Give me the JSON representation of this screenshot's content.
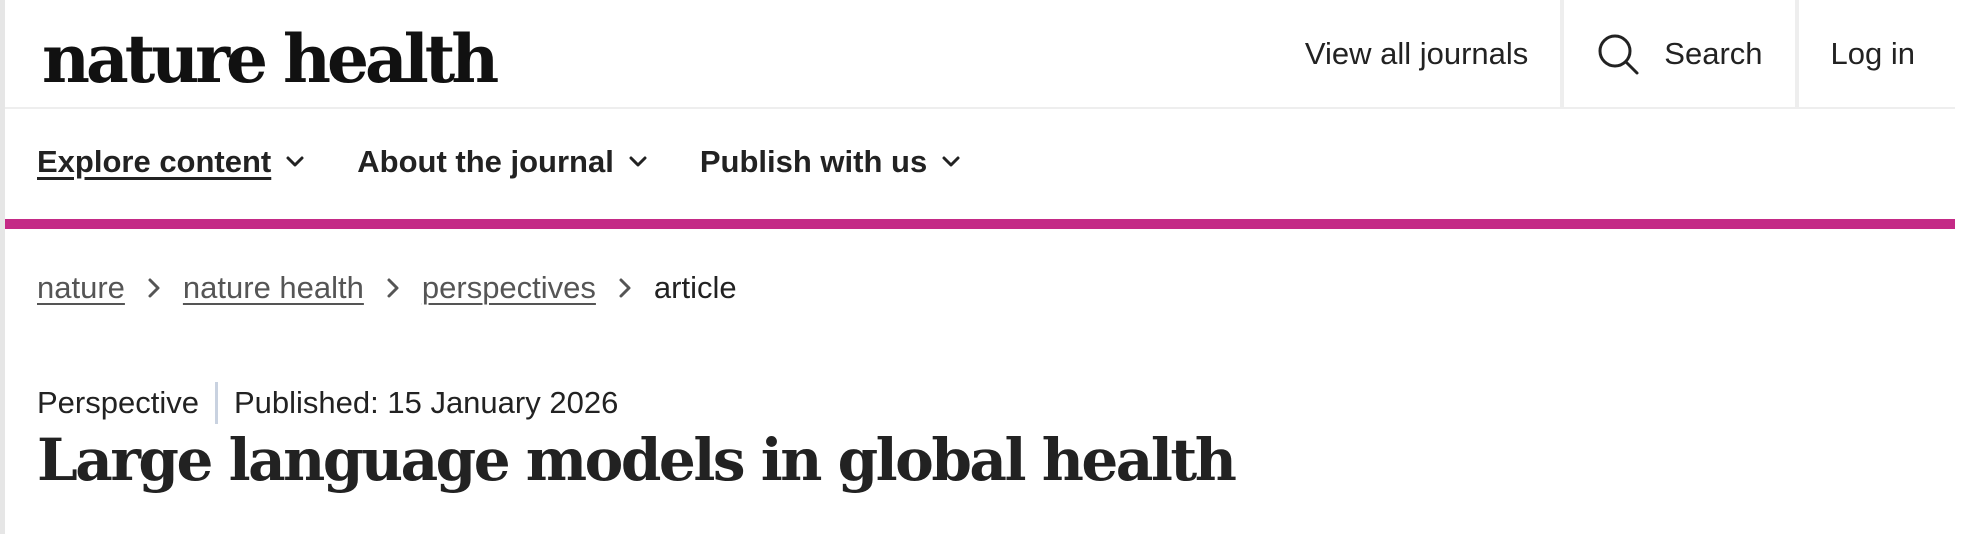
{
  "brand": {
    "logo_text": "nature health",
    "accent_color": "#c42a86"
  },
  "header": {
    "view_all_journals": "View all journals",
    "search_label": "Search",
    "search_icon": "search-icon",
    "login_label": "Log in"
  },
  "nav": {
    "items": [
      {
        "label": "Explore content",
        "icon": "chevron-down-icon",
        "active": true
      },
      {
        "label": "About the journal",
        "icon": "chevron-down-icon",
        "active": false
      },
      {
        "label": "Publish with us",
        "icon": "chevron-down-icon",
        "active": false
      }
    ]
  },
  "breadcrumb": {
    "items": [
      "nature",
      "nature health",
      "perspectives"
    ],
    "current": "article",
    "separator_icon": "chevron-right-icon"
  },
  "article": {
    "type": "Perspective",
    "published": "Published: 15 January 2026",
    "title": "Large language models in global health"
  }
}
